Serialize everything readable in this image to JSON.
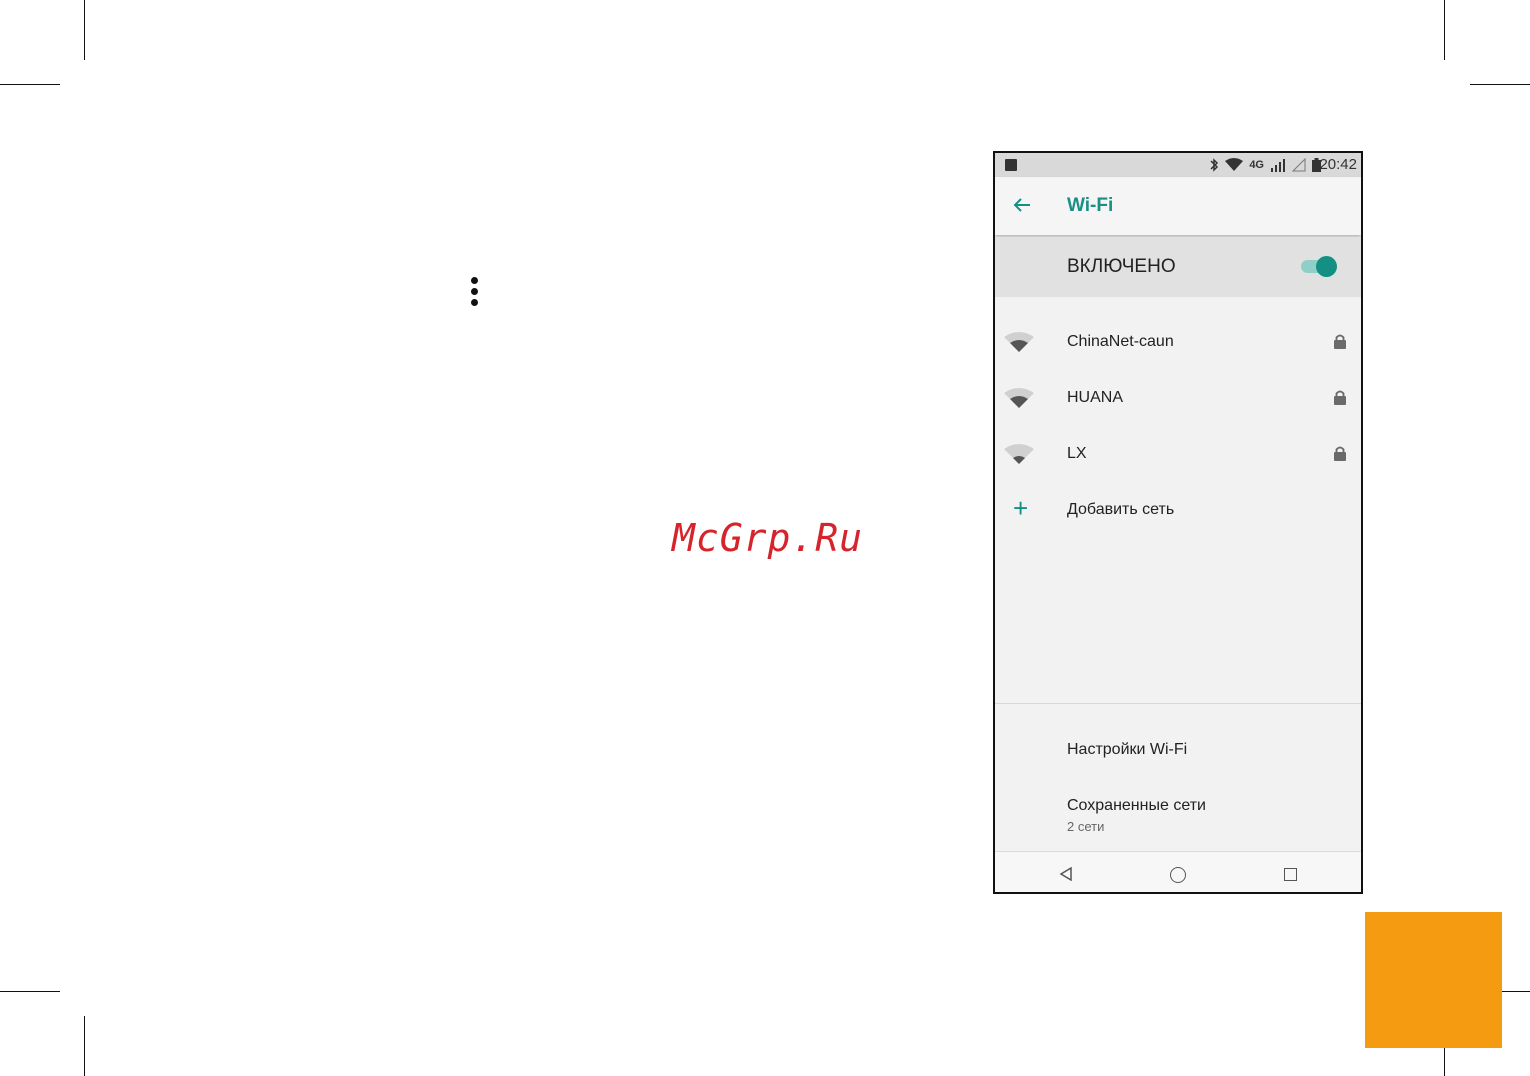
{
  "statusbar": {
    "network": "4G",
    "time": "20:42"
  },
  "appbar": {
    "title": "Wi-Fi"
  },
  "wifi_switch": {
    "label": "ВКЛЮЧЕНО",
    "enabled": true
  },
  "networks": [
    {
      "name": "ChinaNet-caun",
      "locked": true
    },
    {
      "name": "HUANA",
      "locked": true
    },
    {
      "name": "LX",
      "locked": true
    }
  ],
  "add_network": {
    "label": "Добавить сеть"
  },
  "menu": {
    "wifi_settings": "Настройки Wi-Fi",
    "saved_networks": "Сохраненные сети",
    "saved_networks_count": "2 сети"
  },
  "watermark": "McGrp.Ru",
  "colors": {
    "accent": "#1a8f85",
    "orange_tab": "#f59b12",
    "watermark": "#d6242d"
  }
}
